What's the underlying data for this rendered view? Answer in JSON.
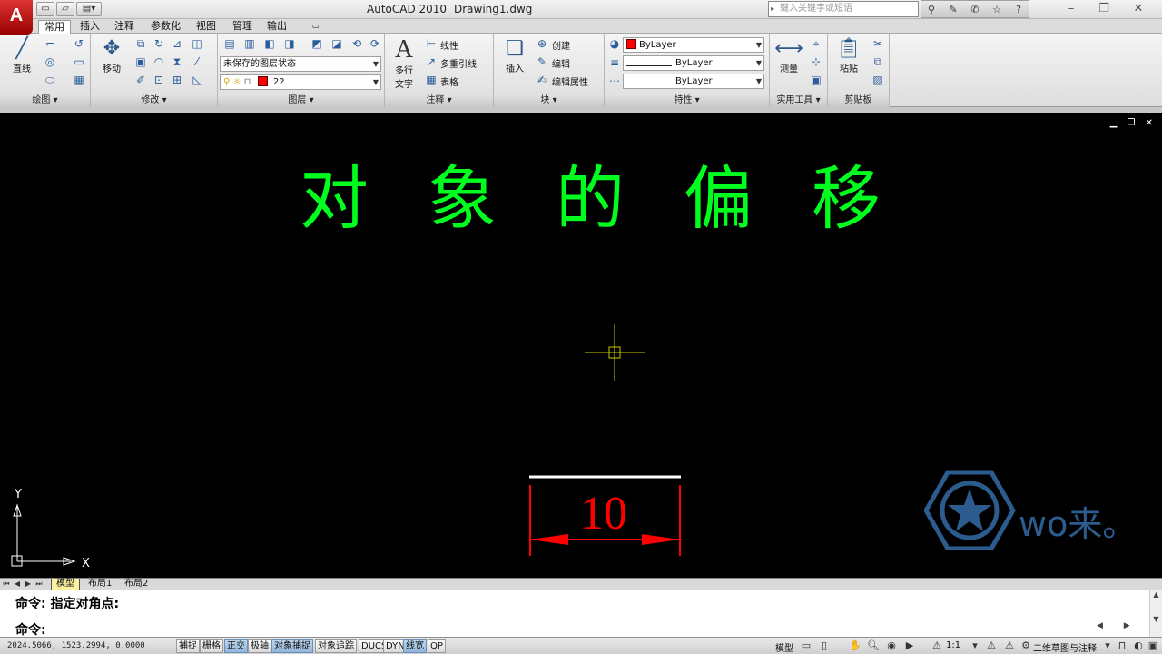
{
  "titlebar": {
    "app_button_letter": "A",
    "app_title": "AutoCAD 2010",
    "document": "Drawing1.dwg",
    "search_placeholder": "键入关键字或短语"
  },
  "ribbon_tabs": [
    "常用",
    "插入",
    "注释",
    "参数化",
    "视图",
    "管理",
    "输出"
  ],
  "panels": {
    "draw": {
      "title": "绘图 ▾",
      "line_label": "直线"
    },
    "modify": {
      "title": "修改 ▾",
      "move_label": "移动"
    },
    "layers": {
      "title": "图层 ▾",
      "layer_state": "未保存的图层状态",
      "current_layer": "22"
    },
    "annotation": {
      "title": "注释 ▾",
      "mtext_label_1": "多行",
      "mtext_label_2": "文字",
      "linear": "线性",
      "multileader": "多重引线",
      "table": "表格"
    },
    "block": {
      "title": "块 ▾",
      "insert": "插入",
      "create": "创建",
      "edit": "编辑",
      "edit_attr": "编辑属性"
    },
    "properties": {
      "title": "特性 ▾",
      "color": "ByLayer",
      "linetype": "ByLayer",
      "lineweight": "ByLayer"
    },
    "utilities": {
      "title": "实用工具 ▾",
      "measure": "测量"
    },
    "clipboard": {
      "title": "剪贴板",
      "paste": "粘贴"
    }
  },
  "drawing": {
    "heading_chars": [
      "对",
      "象",
      "的",
      "偏",
      "移"
    ],
    "dimension_value": "10",
    "ucs_x": "X",
    "ucs_y": "Y",
    "watermark_text": "wo来。"
  },
  "layout_tabs": [
    "模型",
    "布局1",
    "布局2"
  ],
  "command": {
    "history": "命令: 指定对角点:",
    "prompt": "命令:"
  },
  "status": {
    "coordinates": "2024.5066, 1523.2994, 0.0000",
    "toggles": [
      {
        "label": "捕捉",
        "on": false
      },
      {
        "label": "栅格",
        "on": false
      },
      {
        "label": "正交",
        "on": true
      },
      {
        "label": "极轴",
        "on": false
      },
      {
        "label": "对象捕捉",
        "on": true
      },
      {
        "label": "对象追踪",
        "on": false
      },
      {
        "label": "DUCS",
        "on": false
      },
      {
        "label": "DYN",
        "on": false
      },
      {
        "label": "线宽",
        "on": true
      },
      {
        "label": "QP",
        "on": false
      }
    ],
    "model_label": "模型",
    "scale": "1:1",
    "workspace": "二维草图与注释"
  },
  "colors": {
    "canvas": "#000000",
    "heading": "#00ff1e",
    "dimension": "#ff0000",
    "crosshair": "#c8c800",
    "watermark": "#2c5c8e"
  }
}
